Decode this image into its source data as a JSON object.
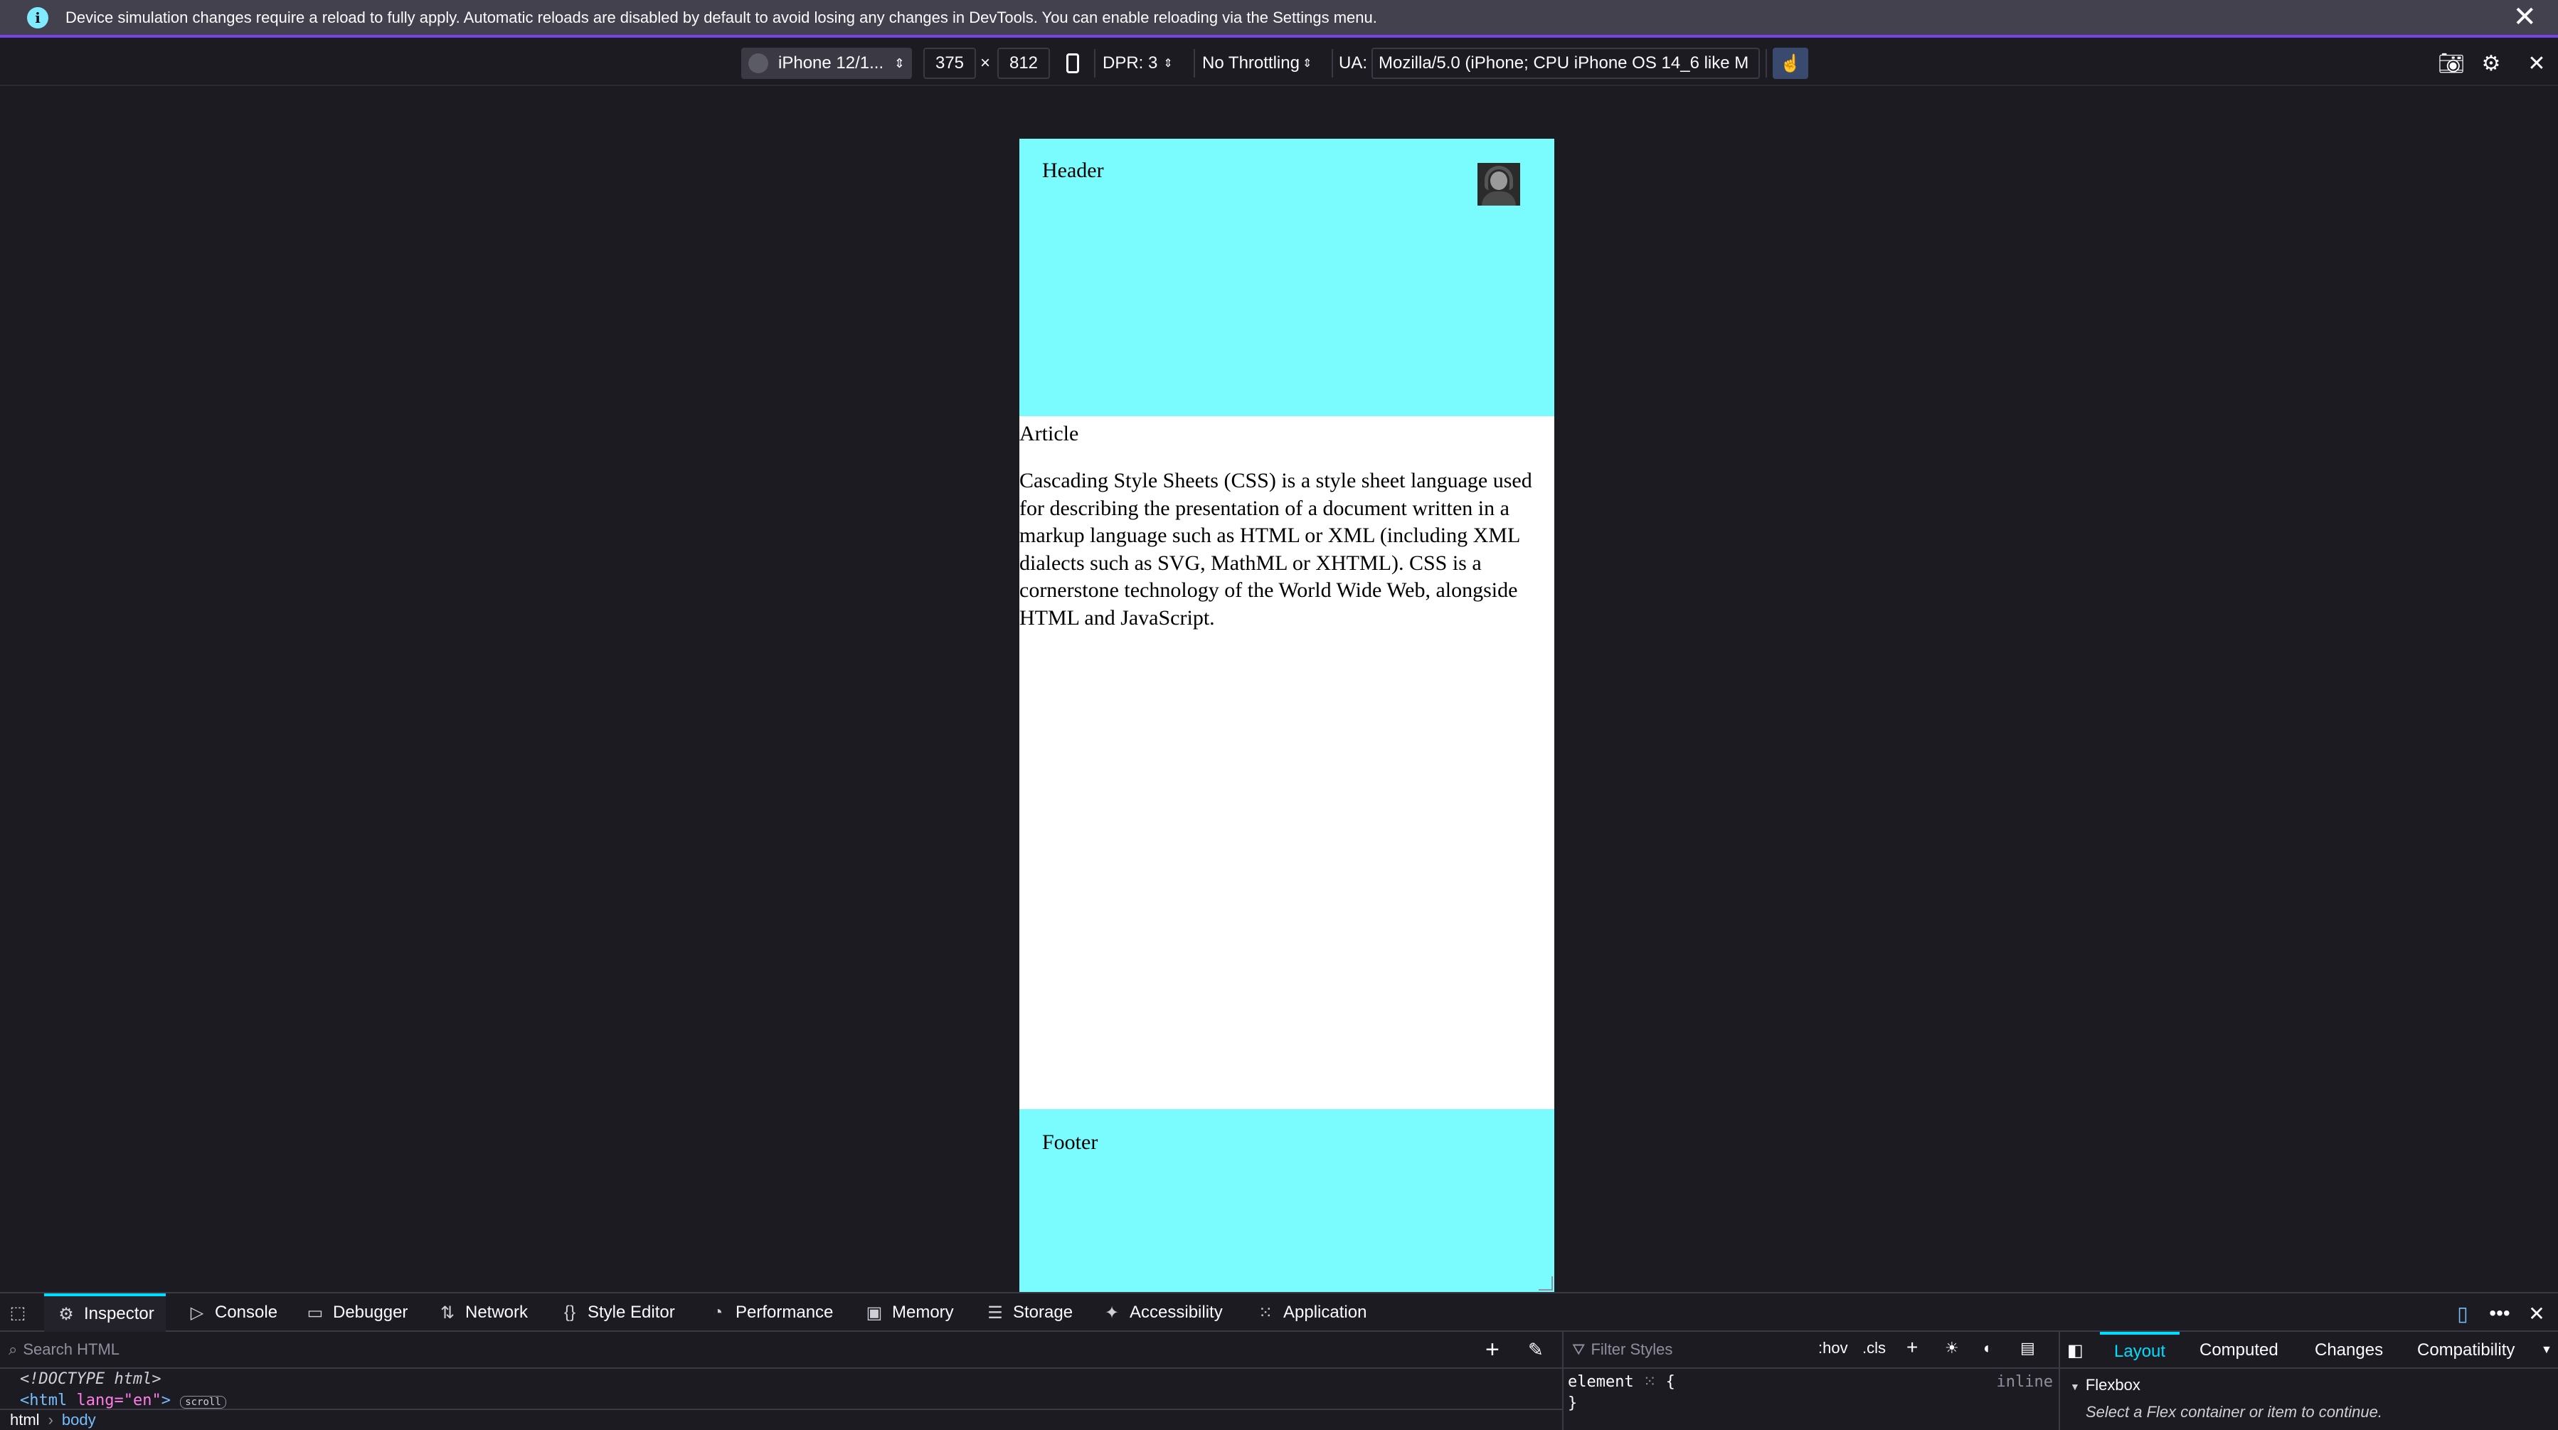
{
  "notification": {
    "message": "Device simulation changes require a reload to fully apply. Automatic reloads are disabled by default to avoid losing any changes in DevTools. You can enable reloading via the Settings menu.",
    "info_glyph": "i",
    "close_glyph": "✕"
  },
  "rdm_toolbar": {
    "device": "iPhone 12/1...",
    "width": "375",
    "times": "×",
    "height": "812",
    "dpr": "DPR: 3",
    "throttling": "No Throttling",
    "ua_label": "UA:",
    "ua_value": "Mozilla/5.0 (iPhone; CPU iPhone OS 14_6 like M"
  },
  "page": {
    "header": "Header",
    "article_title": "Article",
    "article_text": "Cascading Style Sheets (CSS) is a style sheet language used for describing the presentation of a document written in a markup language such as HTML or XML (including XML dialects such as SVG, MathML or XHTML). CSS is a cornerstone technology of the World Wide Web, alongside HTML and JavaScript.",
    "footer": "Footer",
    "header_color": "#7afcff"
  },
  "devtools": {
    "tabs": [
      "Inspector",
      "Console",
      "Debugger",
      "Network",
      "Style Editor",
      "Performance",
      "Memory",
      "Storage",
      "Accessibility",
      "Application"
    ],
    "search_placeholder": "Search HTML",
    "markup_line1": "<!DOCTYPE html>",
    "markup_tag": "<html ",
    "markup_attr": "lang=\"en\"",
    "markup_close": ">",
    "markup_badge": "scroll",
    "breadcrumb_root": "html",
    "breadcrumb_current": "body",
    "filter_placeholder": "Filter Styles",
    "hov": ":hov",
    "cls": ".cls",
    "rule_selector": "element",
    "rule_open": "{",
    "rule_close": "}",
    "rule_inline": "inline",
    "layout_tabs": [
      "Layout",
      "Computed",
      "Changes",
      "Compatibility"
    ],
    "flexbox_title": "Flexbox",
    "flexbox_hint": "Select a Flex container or item to continue."
  }
}
